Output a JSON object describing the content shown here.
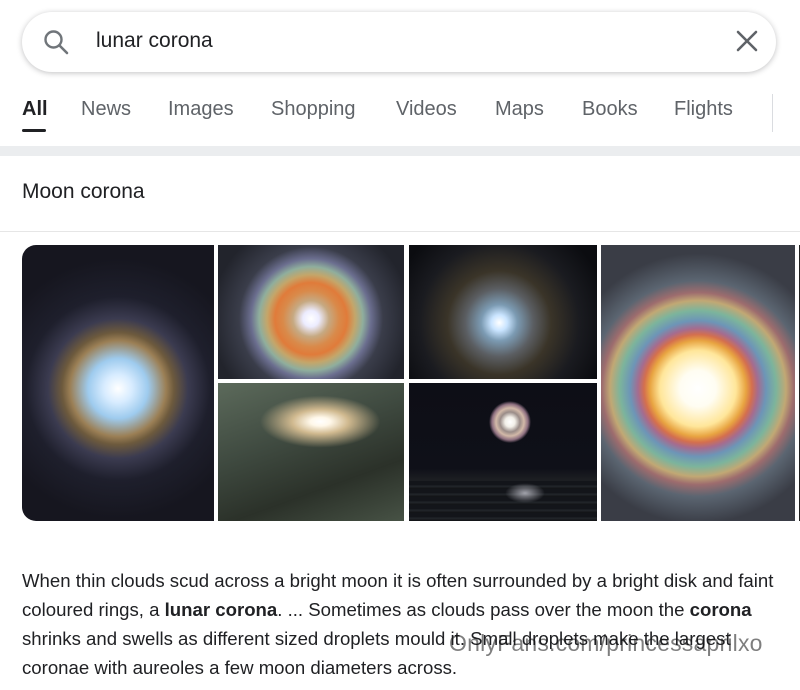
{
  "search": {
    "query": "lunar corona"
  },
  "tabs": [
    {
      "label": "All",
      "active": true
    },
    {
      "label": "News"
    },
    {
      "label": "Images"
    },
    {
      "label": "Shopping"
    },
    {
      "label": "Videos"
    },
    {
      "label": "Maps"
    },
    {
      "label": "Books"
    },
    {
      "label": "Flights"
    }
  ],
  "section": {
    "title": "Moon corona"
  },
  "images": [
    {
      "name": "image-moon-corona-1"
    },
    {
      "name": "image-moon-corona-2"
    },
    {
      "name": "image-moon-corona-3"
    },
    {
      "name": "image-moon-corona-4"
    },
    {
      "name": "image-moon-corona-5"
    },
    {
      "name": "image-moon-corona-6"
    }
  ],
  "description": {
    "part1": "When thin clouds scud across a bright moon it is often surrounded by a bright disk and faint coloured rings, a ",
    "bold1": "lunar corona",
    "part2": ". ... Sometimes as clouds pass over the moon the ",
    "bold2": "corona",
    "part3": " shrinks and swells as different sized droplets mould it. Small droplets make the largest coronae with aureoles a few moon diameters across."
  },
  "watermark": "OnlyFans.com/princessaprilxo",
  "colors": {
    "active_tab": "#202124",
    "inactive_tab": "#5f6368",
    "band": "#ebedef"
  }
}
